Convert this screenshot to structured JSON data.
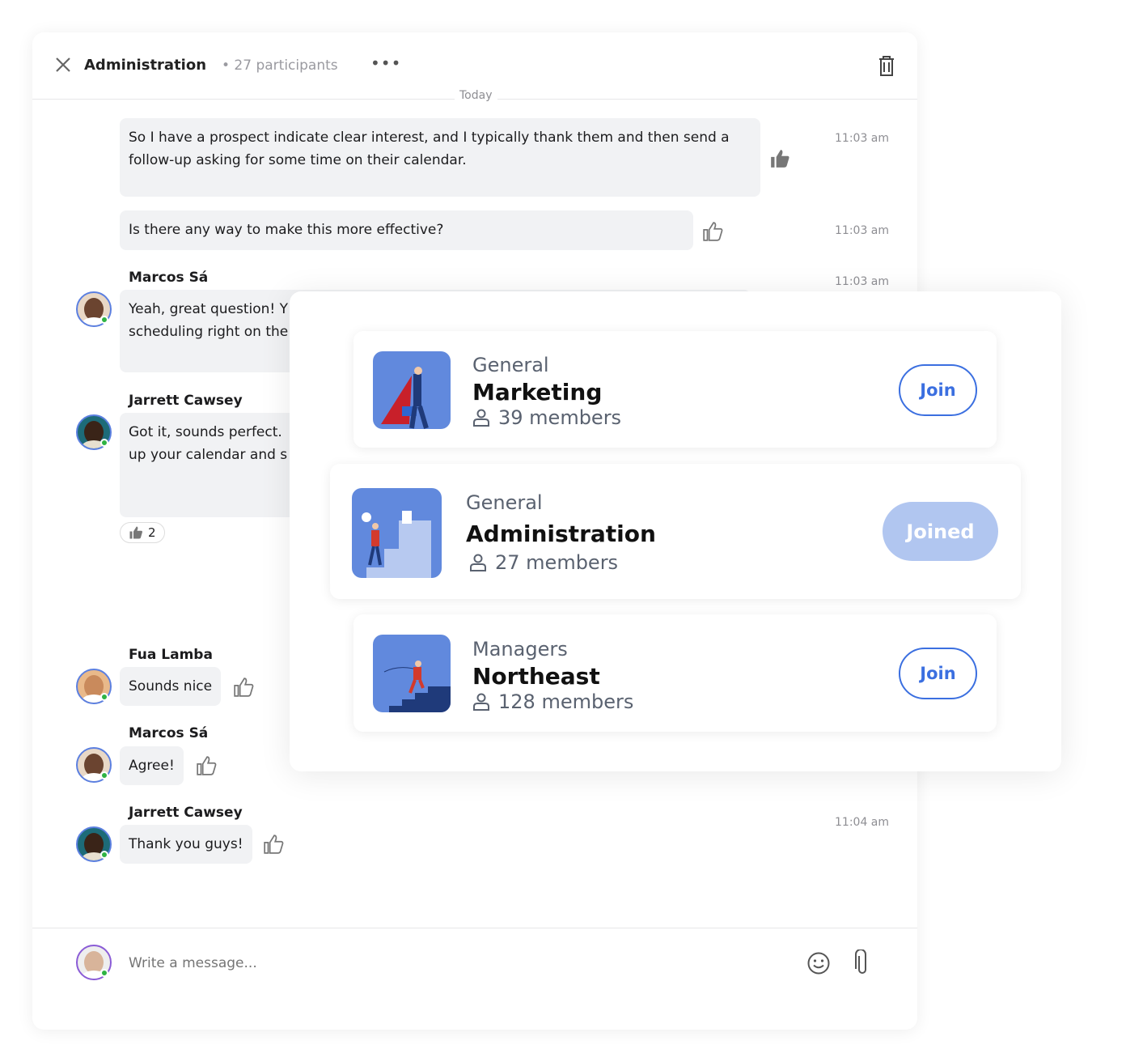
{
  "header": {
    "title": "Administration",
    "participants": "• 27 participants",
    "more_icon": "more-horizontal-icon",
    "close_icon": "close-icon",
    "delete_icon": "trash-icon"
  },
  "divider": "Today",
  "messages": [
    {
      "text": [
        "So I have a prospect indicate clear interest, and I typically thank them and then send a",
        "follow-up asking for some time on their calendar."
      ],
      "time": "11:03 am",
      "liked": true
    },
    {
      "text": [
        "Is there any way to make this more effective?"
      ],
      "time": "11:03 am"
    },
    {
      "author": "Marcos Sá",
      "text": [
        "Yeah, great question! Y",
        "scheduling right on the"
      ],
      "time": "11:03 am"
    },
    {
      "author": "Jarrett Cawsey",
      "text": [
        "Got it, sounds perfect. ",
        "up your calendar and s"
      ],
      "reaction": "2"
    },
    {
      "author": "Fua Lamba",
      "text": [
        "Sounds nice"
      ]
    },
    {
      "author": "Marcos Sá",
      "text": [
        "Agree!"
      ]
    },
    {
      "author": "Jarrett Cawsey",
      "text": [
        "Thank you guys!"
      ],
      "time": "11:04 am"
    }
  ],
  "composer": {
    "placeholder": "Write a message...",
    "emoji_icon": "smiley-icon",
    "attach_icon": "paperclip-icon"
  },
  "groups": [
    {
      "category": "General",
      "name": "Marketing",
      "members": "39 members",
      "action": "Join"
    },
    {
      "category": "General",
      "name": "Administration",
      "members": "27 members",
      "action": "Joined"
    },
    {
      "category": "Managers",
      "name": "Northeast",
      "members": "128 members",
      "action": "Join"
    }
  ],
  "colors": {
    "accent": "#3b6fe0",
    "joined": "#b1c6f0",
    "online": "#2fb344",
    "bubble": "#f1f2f4"
  }
}
